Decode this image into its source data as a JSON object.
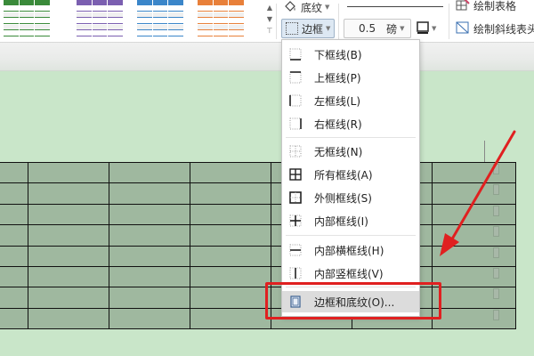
{
  "ribbon": {
    "shading_label": "底纹",
    "border_label": "边框",
    "line_width_value": "0.5",
    "line_width_unit": "磅",
    "draw_table_label": "绘制表格",
    "draw_diagonal_label": "绘制斜线表头"
  },
  "gallery": {
    "swatches": [
      {
        "color": "#3a8a3a"
      },
      {
        "color": "#7b5fb0"
      },
      {
        "color": "#3b86c9"
      },
      {
        "color": "#e8803a"
      }
    ]
  },
  "menu": {
    "items": [
      {
        "label": "下框线(B)"
      },
      {
        "label": "上框线(P)"
      },
      {
        "label": "左框线(L)"
      },
      {
        "label": "右框线(R)"
      },
      {
        "label": "无框线(N)"
      },
      {
        "label": "所有框线(A)"
      },
      {
        "label": "外侧框线(S)"
      },
      {
        "label": "内部框线(I)"
      },
      {
        "label": "内部横框线(H)"
      },
      {
        "label": "内部竖框线(V)"
      },
      {
        "label": "边框和底纹(O)..."
      }
    ]
  },
  "colors": {
    "page_bg": "#c9e6c9",
    "table_fill": "#9fb89f",
    "highlight": "#e02020",
    "menu_hover": "#dcdcdc"
  }
}
